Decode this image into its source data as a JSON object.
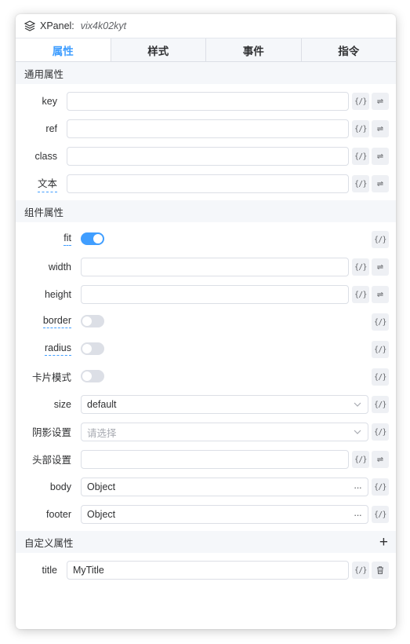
{
  "header": {
    "title": "XPanel:",
    "id": "vix4k02kyt",
    "icon": "layers-icon"
  },
  "tabs": [
    "属性",
    "样式",
    "事件",
    "指令"
  ],
  "sections": {
    "common": "通用属性",
    "component": "组件属性",
    "custom": "自定义属性"
  },
  "common_props": [
    {
      "label": "key",
      "value": ""
    },
    {
      "label": "ref",
      "value": ""
    },
    {
      "label": "class",
      "value": ""
    },
    {
      "label": "文本",
      "value": ""
    }
  ],
  "component_props": {
    "fit": {
      "label": "fit",
      "on": true
    },
    "width": {
      "label": "width",
      "value": ""
    },
    "height": {
      "label": "height",
      "value": ""
    },
    "border": {
      "label": "border",
      "on": false
    },
    "radius": {
      "label": "radius",
      "on": false
    },
    "card": {
      "label": "卡片模式",
      "on": false
    },
    "size": {
      "label": "size",
      "value": "default"
    },
    "shadow": {
      "label": "阴影设置",
      "placeholder": "请选择"
    },
    "head": {
      "label": "头部设置",
      "value": ""
    },
    "body": {
      "label": "body",
      "value": "Object"
    },
    "footer": {
      "label": "footer",
      "value": "Object"
    }
  },
  "custom_props": [
    {
      "label": "title",
      "value": "MyTitle"
    }
  ],
  "binding_button_glyph": "{/}",
  "switch_glyph": "⇌",
  "more_glyph": "···",
  "add_glyph": "+",
  "colors": {
    "accent": "#409eff",
    "section_bg": "#f5f7fa",
    "border": "#dcdfe6"
  }
}
